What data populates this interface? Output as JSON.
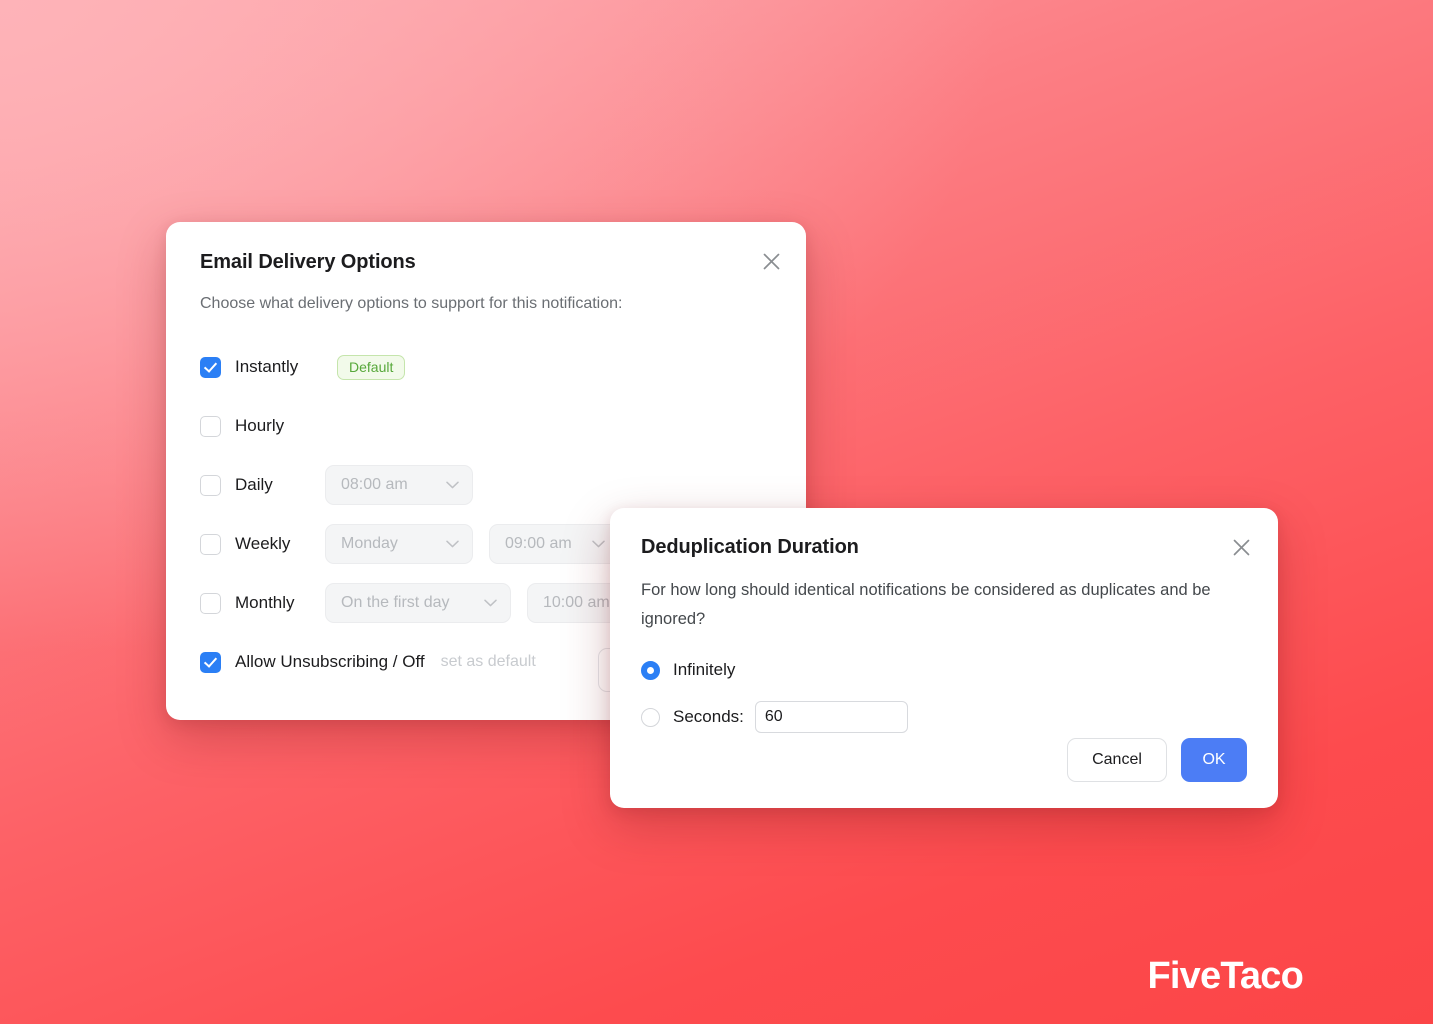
{
  "background": {
    "gradient_from": "#FCA6AC",
    "gradient_to": "#FD4B4E"
  },
  "watermark": {
    "text": "FiveTaco",
    "color": "#FFFFFF"
  },
  "email_dialog": {
    "title": "Email Delivery Options",
    "subtitle": "Choose what delivery options to support for this notification:",
    "close_icon": "close-icon",
    "options": [
      {
        "label": "Instantly",
        "checked": true,
        "badge": "Default"
      },
      {
        "label": "Hourly",
        "checked": false
      },
      {
        "label": "Daily",
        "checked": false,
        "time": "08:00 am"
      },
      {
        "label": "Weekly",
        "checked": false,
        "day": "Monday",
        "time": "09:00 am"
      },
      {
        "label": "Monthly",
        "checked": false,
        "day": "On the first day",
        "time": "10:00 am"
      }
    ],
    "unsubscribe": {
      "label": "Allow Unsubscribing / Off",
      "checked": true,
      "hint": "set as default"
    },
    "accent_checked": "#2B7FF5",
    "badge_colors": {
      "text": "#57A83A",
      "background": "#F2FAEA",
      "border": "#C5E5AC"
    }
  },
  "dedup_dialog": {
    "title": "Deduplication Duration",
    "subtitle": "For how long should identical notifications be considered as duplicates and be ignored?",
    "close_icon": "close-icon",
    "radios": [
      {
        "label": "Infinitely",
        "selected": true
      },
      {
        "label": "Seconds:",
        "selected": false
      }
    ],
    "seconds_value": "60",
    "buttons": {
      "cancel": "Cancel",
      "ok": "OK"
    },
    "accent_primary": "#4C7DF5"
  }
}
